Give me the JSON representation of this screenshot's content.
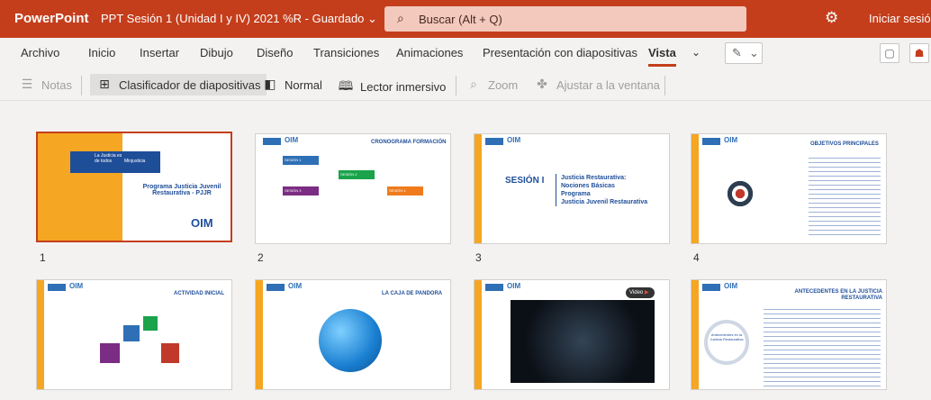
{
  "titlebar": {
    "app": "PowerPoint",
    "document": "PPT Sesión 1 (Unidad I y IV) 2021 %R - Guardado ⌄",
    "search_placeholder": "Buscar (Alt + Q)",
    "signin": "Iniciar sesión"
  },
  "tabs": [
    "Archivo",
    "Inicio",
    "Insertar",
    "Dibujo",
    "Diseño",
    "Transiciones",
    "Animaciones",
    "Presentación con diapositivas",
    "Vista"
  ],
  "active_tab": "Vista",
  "commands": {
    "notas": "Notas",
    "clasificador": "Clasificador de diapositivas",
    "normal": "Normal",
    "lector": "Lector inmersivo",
    "zoom": "Zoom",
    "ajustar": "Ajustar a la ventana"
  },
  "slides": [
    {
      "num": "1",
      "title": "Programa Justicia Juvenil Restaurativa - PJJR",
      "badge": "Minjusticia",
      "logo_text": "La Justicia es de todos",
      "oim": "OIM"
    },
    {
      "num": "2",
      "title": "CRONOGRAMA FORMACIÓN",
      "items": [
        "SESIÓN 1",
        "SESIÓN 2",
        "SESIÓN 3",
        "SESIÓN 4"
      ]
    },
    {
      "num": "3",
      "title": "SESIÓN I",
      "subtitle1": "Justicia Restaurativa:",
      "subtitle2": "Nociones Básicas",
      "subtitle3": "Programa",
      "subtitle4": "Justicia Juvenil Restaurativa"
    },
    {
      "num": "4",
      "title": "OBJETIVOS PRINCIPALES"
    },
    {
      "num": "",
      "title": "ACTIVIDAD INICIAL"
    },
    {
      "num": "",
      "title": "LA CAJA DE PANDORA"
    },
    {
      "num": "",
      "title": "",
      "video_label": "Video"
    },
    {
      "num": "",
      "title": "ANTECEDENTES EN LA JUSTICIA RESTAURATIVA",
      "circle_label": "Antecedentes en la Justicia Restaurativa"
    }
  ],
  "colors": {
    "accent": "#c43e1c",
    "slide_yellow": "#f5a623",
    "slide_blue": "#1f4e99"
  }
}
